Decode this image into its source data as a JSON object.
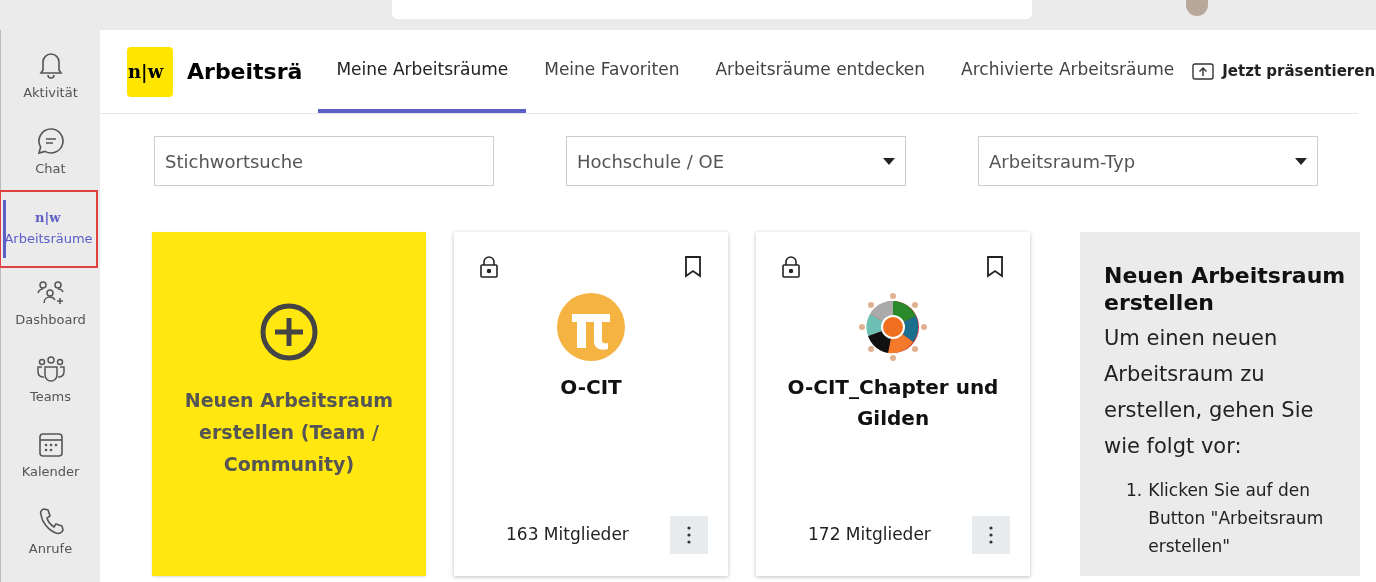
{
  "rail": [
    {
      "label": "Aktivität",
      "kind": "bell",
      "selected": false
    },
    {
      "label": "Chat",
      "kind": "chat",
      "selected": false
    },
    {
      "label": "Arbeitsräume",
      "kind": "logo",
      "logo": "n|w",
      "selected": true
    },
    {
      "label": "Dashboard",
      "kind": "people",
      "selected": false
    },
    {
      "label": "Teams",
      "kind": "teams",
      "selected": false
    },
    {
      "label": "Kalender",
      "kind": "calendar",
      "selected": false
    },
    {
      "label": "Anrufe",
      "kind": "phone",
      "selected": false
    }
  ],
  "header": {
    "logo": "n|w",
    "title": "Arbeitsrä",
    "present": "Jetzt präsentieren"
  },
  "tabs": [
    {
      "label": "Meine Arbeitsräume",
      "selected": true
    },
    {
      "label": "Meine Favoriten",
      "selected": false
    },
    {
      "label": "Arbeitsräume entdecken",
      "selected": false
    },
    {
      "label": "Archivierte Arbeitsräume",
      "selected": false
    }
  ],
  "filters": {
    "search": {
      "placeholder": "Stichwortsuche"
    },
    "dropdowns": [
      {
        "placeholder": "Hochschule / OE"
      },
      {
        "placeholder": "Arbeitsraum-Typ"
      }
    ]
  },
  "create_card": {
    "label": "Neuen Arbeitsraum erstellen (Team / Community)"
  },
  "workspaces": [
    {
      "name": "O-CIT",
      "members": "163 Mitglieder",
      "kind": "pi"
    },
    {
      "name": "O-CIT_Chapter und Gilden",
      "members": "172 Mitglieder",
      "kind": "circle"
    }
  ],
  "help": {
    "title": "Neuen Arbeitsraum erstellen",
    "text": "Um einen neuen Arbeitsraum zu erstellen, gehen Sie wie folgt vor:",
    "steps": [
      {
        "number": "1.",
        "text": "Klicken Sie auf den Button \"Arbeitsraum erstellen\""
      }
    ]
  }
}
